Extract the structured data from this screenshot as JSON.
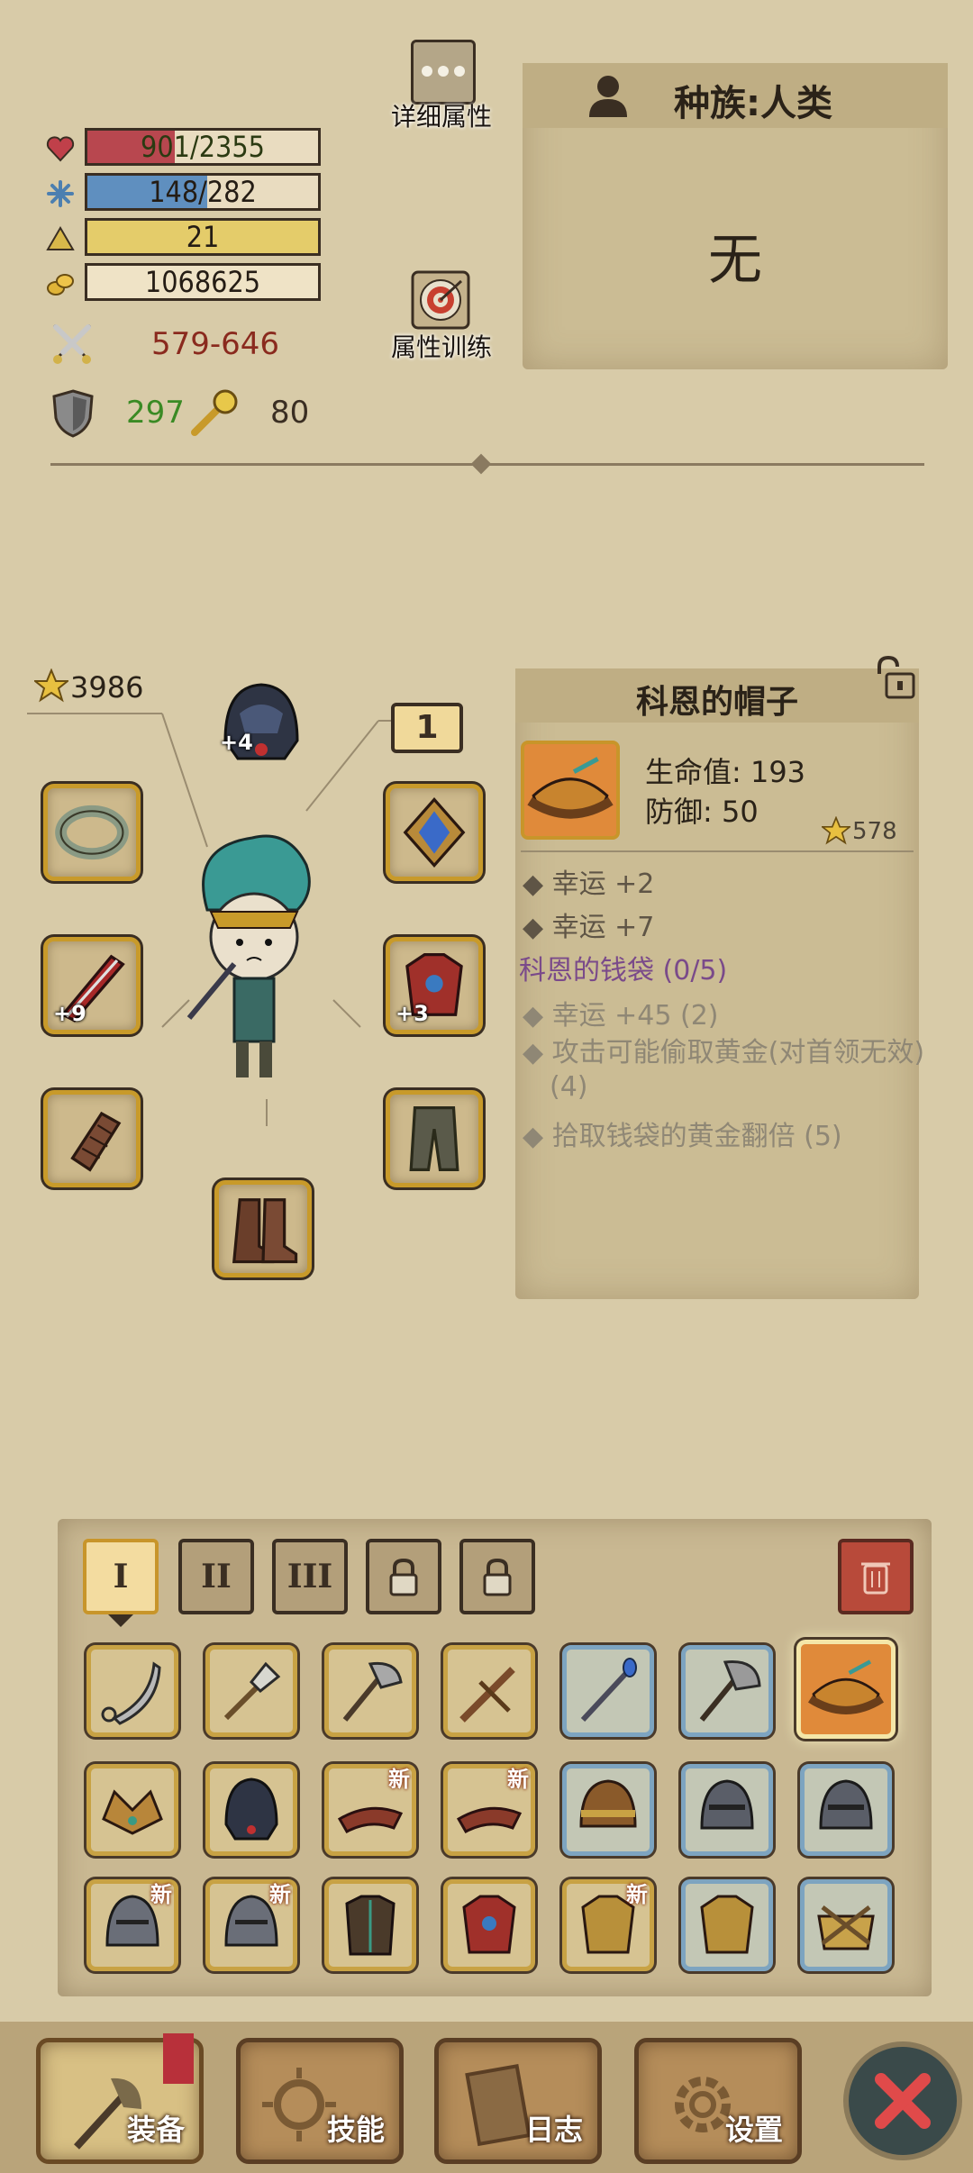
{
  "stats": {
    "hp": "901/2355",
    "hp_fill": 0.38,
    "mana": "148/282",
    "mana_fill": 0.52,
    "level": "21",
    "gold": "1068625",
    "attack": "579-646",
    "defense": "297",
    "luck": "80"
  },
  "buttons": {
    "detail_attributes": "详细属性",
    "attribute_training": "属性训练"
  },
  "race": {
    "label": "种族:人类",
    "value": "无"
  },
  "character": {
    "gear_score": "3986",
    "helmet_level": "+4",
    "weapon_level": "+9",
    "armor_level": "+3",
    "page_number": "1"
  },
  "item_detail": {
    "name": "科恩的帽子",
    "stat_hp": "生命值: 193",
    "stat_defense": "防御: 50",
    "score": "578",
    "bonuses": [
      "幸运 +2",
      "幸运 +7"
    ],
    "set_name": "科恩的钱袋 (0/5)",
    "set_bonuses": [
      "幸运 +45 (2)",
      "攻击可能偷取黄金(对首领无效) (4)",
      "拾取钱袋的黄金翻倍 (5)"
    ]
  },
  "inventory": {
    "tabs": [
      "I",
      "II",
      "III"
    ],
    "new_badge": "新"
  },
  "nav": {
    "equipment": "装备",
    "skills": "技能",
    "log": "日志",
    "settings": "设置"
  },
  "colors": {
    "hp": "#b8474f",
    "mana": "#5f8fbf",
    "level": "#e4cc6a",
    "attack_text": "#8a2a1e",
    "defense_text": "#3a8a24",
    "set_name": "#7a4a8a"
  }
}
